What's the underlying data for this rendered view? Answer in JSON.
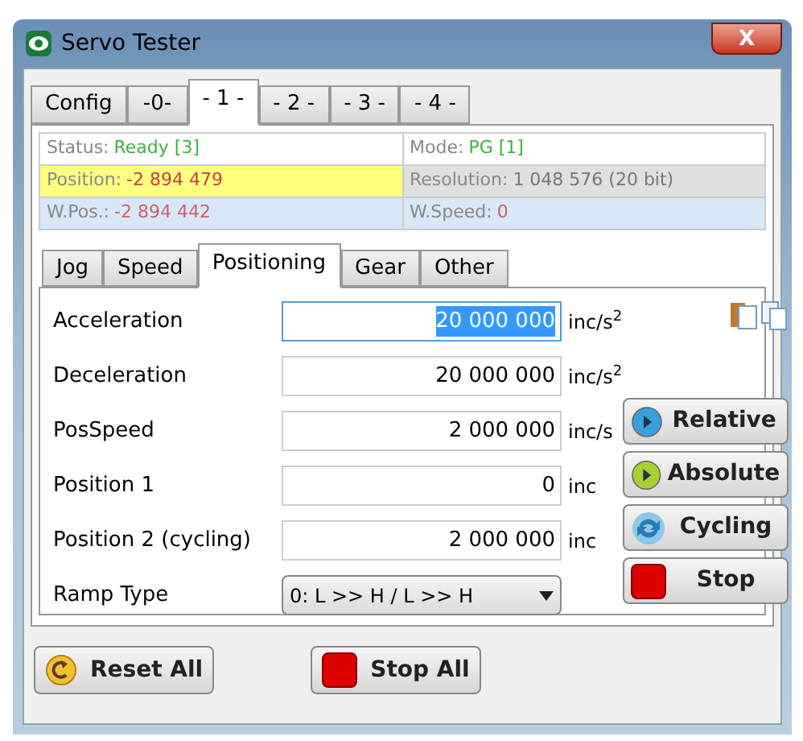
{
  "window": {
    "title": "Servo Tester",
    "close": "X"
  },
  "tabs": [
    {
      "label": "Config",
      "selected": false
    },
    {
      "label": "-0-",
      "selected": false
    },
    {
      "label": "- 1 -",
      "selected": true
    },
    {
      "label": "- 2 -",
      "selected": false
    },
    {
      "label": "- 3 -",
      "selected": false
    },
    {
      "label": "- 4 -",
      "selected": false
    }
  ],
  "info": [
    {
      "label": "Status:",
      "value": "Ready [3]",
      "kind": "ok",
      "color": "#ffffff"
    },
    {
      "label": "Mode:",
      "value": "PG [1]",
      "kind": "ok",
      "color": "#ffffff"
    },
    {
      "label": "Position:",
      "value": "-2 894 479",
      "kind": "warn",
      "color": "#ffff80"
    },
    {
      "label": "Resolution:",
      "value": "1 048 576 (20 bit)",
      "kind": "plain",
      "color": "#e0e0e0"
    },
    {
      "label": "W.Pos.:",
      "value": "-2 894 442",
      "kind": "alert",
      "color": "#d8e8f8"
    },
    {
      "label": "W.Speed:",
      "value": "0",
      "kind": "alert",
      "color": "#d8e8f8"
    }
  ],
  "subtabs": [
    {
      "label": "Jog",
      "selected": false
    },
    {
      "label": "Speed",
      "selected": false
    },
    {
      "label": "Positioning",
      "selected": true
    },
    {
      "label": "Gear",
      "selected": false
    },
    {
      "label": "Other",
      "selected": false
    }
  ],
  "fields": [
    {
      "label": "Acceleration",
      "value": "20 000 000",
      "unit": "inc/s$^{2}$",
      "focused": true
    },
    {
      "label": "Deceleration",
      "value": "20 000 000",
      "unit": "inc/s$^{2}$",
      "focused": false
    },
    {
      "label": "PosSpeed",
      "value": "2 000 000",
      "unit": "inc/s",
      "focused": false
    },
    {
      "label": "Position 1",
      "value": "0",
      "unit": "inc",
      "focused": false
    },
    {
      "label": "Position 2 (cycling)",
      "value": "2 000 000",
      "unit": "inc",
      "focused": false
    }
  ],
  "ramp": {
    "label": "Ramp Type",
    "value": "0: L >> H / L >> H"
  },
  "actions": [
    {
      "label": "Relative",
      "kind": "play-blue"
    },
    {
      "label": "Absolute",
      "kind": "play-green"
    },
    {
      "label": "Cycling",
      "kind": "cycle"
    },
    {
      "label": "Stop",
      "kind": "stop"
    }
  ],
  "footer": [
    {
      "label": "Reset All",
      "kind": "reset"
    },
    {
      "label": "Stop All",
      "kind": "stop"
    }
  ]
}
